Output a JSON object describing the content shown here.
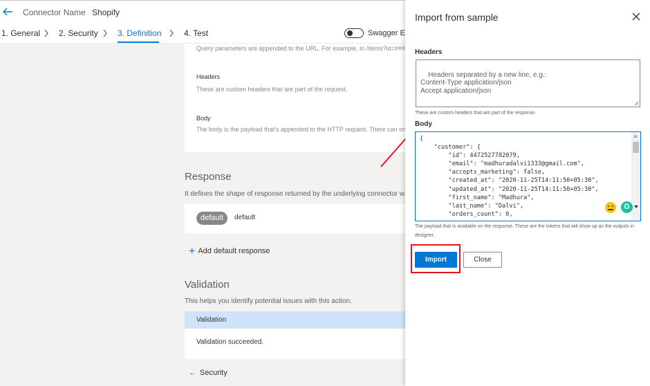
{
  "header": {
    "connector_label": "Connector Name",
    "connector_name": "Shopify"
  },
  "tabs": [
    {
      "label": "1. General"
    },
    {
      "label": "2. Security"
    },
    {
      "label": "3. Definition"
    },
    {
      "label": "4. Test"
    }
  ],
  "toggle": {
    "label": "Swagger Edi",
    "on": false
  },
  "request": {
    "query_help": "Query parameters are appended to the URL. For example, in /items?id=####, th",
    "headers_label": "Headers",
    "headers_help": "These are custom headers that are part of the request.",
    "body_label": "Body",
    "body_help": "The body is the payload that's appended to the HTTP request. There can only be"
  },
  "response": {
    "title": "Response",
    "desc": "It defines the shape of response returned by the underlying connector w",
    "pill": "default",
    "pill_text": "default",
    "add_label": "Add default response"
  },
  "validation": {
    "title": "Validation",
    "desc": "This helps you identify potential issues with this action.",
    "header": "Validation",
    "result": "Validation succeeded."
  },
  "footer": {
    "back_label": "Security"
  },
  "panel": {
    "title": "Import from sample",
    "headers_label": "Headers",
    "headers_placeholder": "Headers separated by a new line, e.g.:\nContent-Type application/json\nAccept application/json",
    "headers_help": "These are custom headers that are part of the response.",
    "body_label": "Body",
    "body_code": "{\n    \"customer\": {\n        \"id\": 4472527782079,\n        \"email\": \"madhuradalvi1333@gmail.com\",\n        \"accepts_marketing\": false,\n        \"created_at\": \"2020-11-25T14:11:50+05:30\",\n        \"updated_at\": \"2020-11-25T14:11:50+05:30\",\n        \"first_name\": \"Madhura\",\n        \"last_name\": \"Dalvi\",\n        \"orders_count\": 0,",
    "body_help": "The payload that is available on the response. These are the tokens that will show up as the outputs in designer.",
    "import_label": "Import",
    "close_label": "Close",
    "grammarly_glyph": "G"
  },
  "colors": {
    "accent": "#0078d4",
    "annotation": "#e81123",
    "validation_header": "#cfe4fa",
    "grammarly": "#15c39a"
  },
  "icons": [
    "back-arrow-icon",
    "chevron-right-icon",
    "close-icon",
    "plus-icon",
    "arrow-left-icon",
    "emoji-icon",
    "grammarly-icon",
    "resize-handle-icon"
  ]
}
